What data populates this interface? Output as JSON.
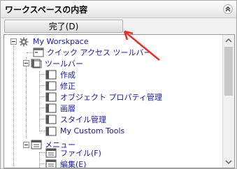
{
  "panel": {
    "title": "ワークスペースの内容",
    "done_button": "完了(D)"
  },
  "tree": {
    "root": "My Worskpace",
    "quick_access": "クイック アクセス ツールバー",
    "toolbars": "ツールバー",
    "toolbar_items": [
      "作成",
      "修正",
      "オブジェクト プロパティ管理",
      "画層",
      "スタイル管理",
      "My Custom Tools"
    ],
    "menus": "メニュー",
    "menu_items": [
      "ファイル(F)",
      "編集(E)"
    ]
  },
  "colors": {
    "tree_text": "#1a1aa0",
    "annotation_arrow": "#e8312a"
  },
  "icons": {
    "collapse": "double-chevron-up-icon",
    "root": "gear-icon",
    "toolbar": "toolbar-icon",
    "menu": "menu-icon"
  }
}
